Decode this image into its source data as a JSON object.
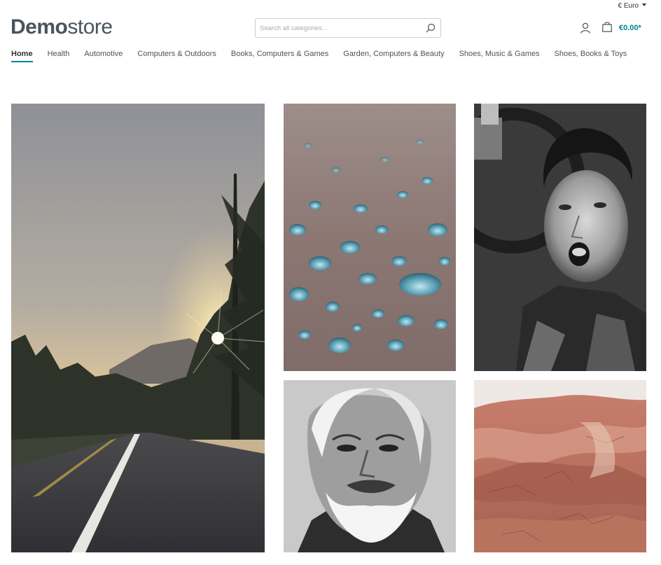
{
  "currency": {
    "label": "€ Euro"
  },
  "logo": {
    "bold": "Demo",
    "light": "store"
  },
  "search": {
    "placeholder": "Search all categories..."
  },
  "cart": {
    "total": "€0.00*"
  },
  "nav": {
    "items": [
      "Home",
      "Health",
      "Automotive",
      "Computers & Outdoors",
      "Books, Computers & Games",
      "Garden, Computers & Beauty",
      "Shoes, Music & Games",
      "Shoes, Books & Toys"
    ]
  },
  "colors": {
    "accent": "#008490",
    "text": "#4a545b"
  },
  "icons": {
    "search": "search-icon",
    "account": "user-icon",
    "cart": "shopping-bag-icon",
    "currency_toggle": "caret-down-icon"
  }
}
